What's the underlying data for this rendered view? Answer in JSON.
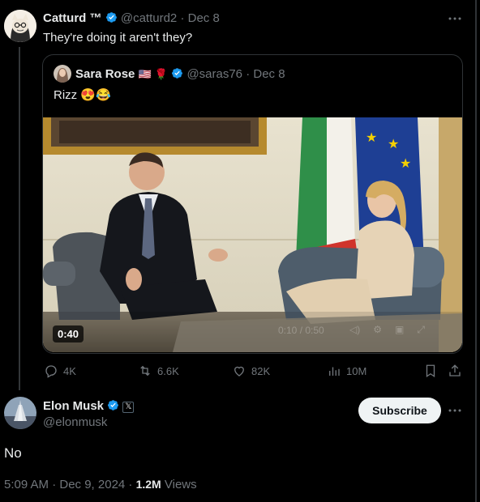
{
  "tweet": {
    "author_name": "Catturd ™",
    "handle": "@catturd2",
    "date": "· Dec 8",
    "text": "They're doing it aren't they?",
    "more_icon": "more-icon"
  },
  "quote": {
    "author_name": "Sara Rose",
    "flag_emoji": "🇺🇸",
    "rose_emoji": "🌹",
    "handle": "@saras76",
    "date": "· Dec 8",
    "text": "Rizz 😍😂",
    "video_duration": "0:40",
    "player_overlay_time": "0:10 / 0:50"
  },
  "actions": {
    "replies": "4K",
    "reposts": "6.6K",
    "likes": "82K",
    "views": "10M"
  },
  "reply": {
    "author_name": "Elon Musk",
    "handle": "@elonmusk",
    "affiliate_badge": "𝕏",
    "subscribe_label": "Subscribe",
    "text": "No",
    "timestamp": "5:09 AM · Dec 9, 2024 ·",
    "views_count": "1.2M",
    "views_label": "Views"
  },
  "colors": {
    "accent": "#1d9bf0",
    "muted": "#71767b",
    "background": "#000000"
  }
}
